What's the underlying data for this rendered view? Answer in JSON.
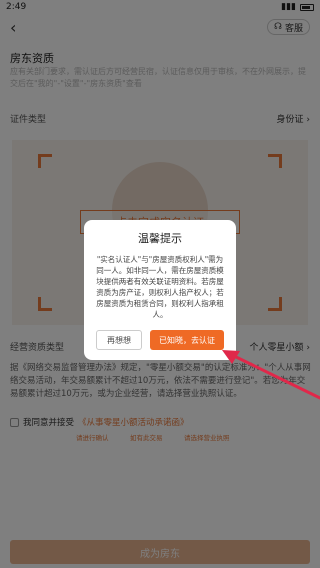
{
  "status": {
    "time": "2:49"
  },
  "header": {
    "service_label": "客服"
  },
  "page": {
    "title": "房东资质",
    "notice": "应有关部门要求，需认证后方可经营民宿，认证信息仅用于审核，不在外网展示，提交后在\"我的\"-\"设置\"-\"房东资质\"查看",
    "id_type_label": "证件类型",
    "id_type_value": "身份证",
    "auth_cta": "点击完成实名认证",
    "business_type_label": "经营资质类型",
    "business_type_value": "个人零星小额",
    "law_text": "据《网络交易监督管理办法》规定，\"零星小额交易\"的认定标准为：\"个人从事网络交易活动，年交易额累计不超过10万元，依法不需要进行登记\"。若您为年交易额累计超过10万元，或为企业经营，请选择营业执照认证。",
    "agree_prefix": "我同意并接受",
    "agree_link": "《从事零星小额活动承诺函》",
    "tip_1": "请进行确认",
    "tip_2": "如有此交易",
    "tip_3": "请选择营业执照",
    "submit_label": "成为房东"
  },
  "dialog": {
    "title": "温馨提示",
    "body": "\"实名认证人\"与\"房屋资质权利人\"需为同一人。如非同一人，需在房屋资质模块提供两者有效关联证明资料。若房屋资质为房产证，则权利人指产权人；若房屋资质为租赁合同，则权利人指承租人。",
    "cancel_label": "再想想",
    "confirm_label": "已知晓，去认证"
  },
  "colors": {
    "accent": "#ef6a25",
    "overlay": "rgba(0,0,0,0.5)"
  }
}
